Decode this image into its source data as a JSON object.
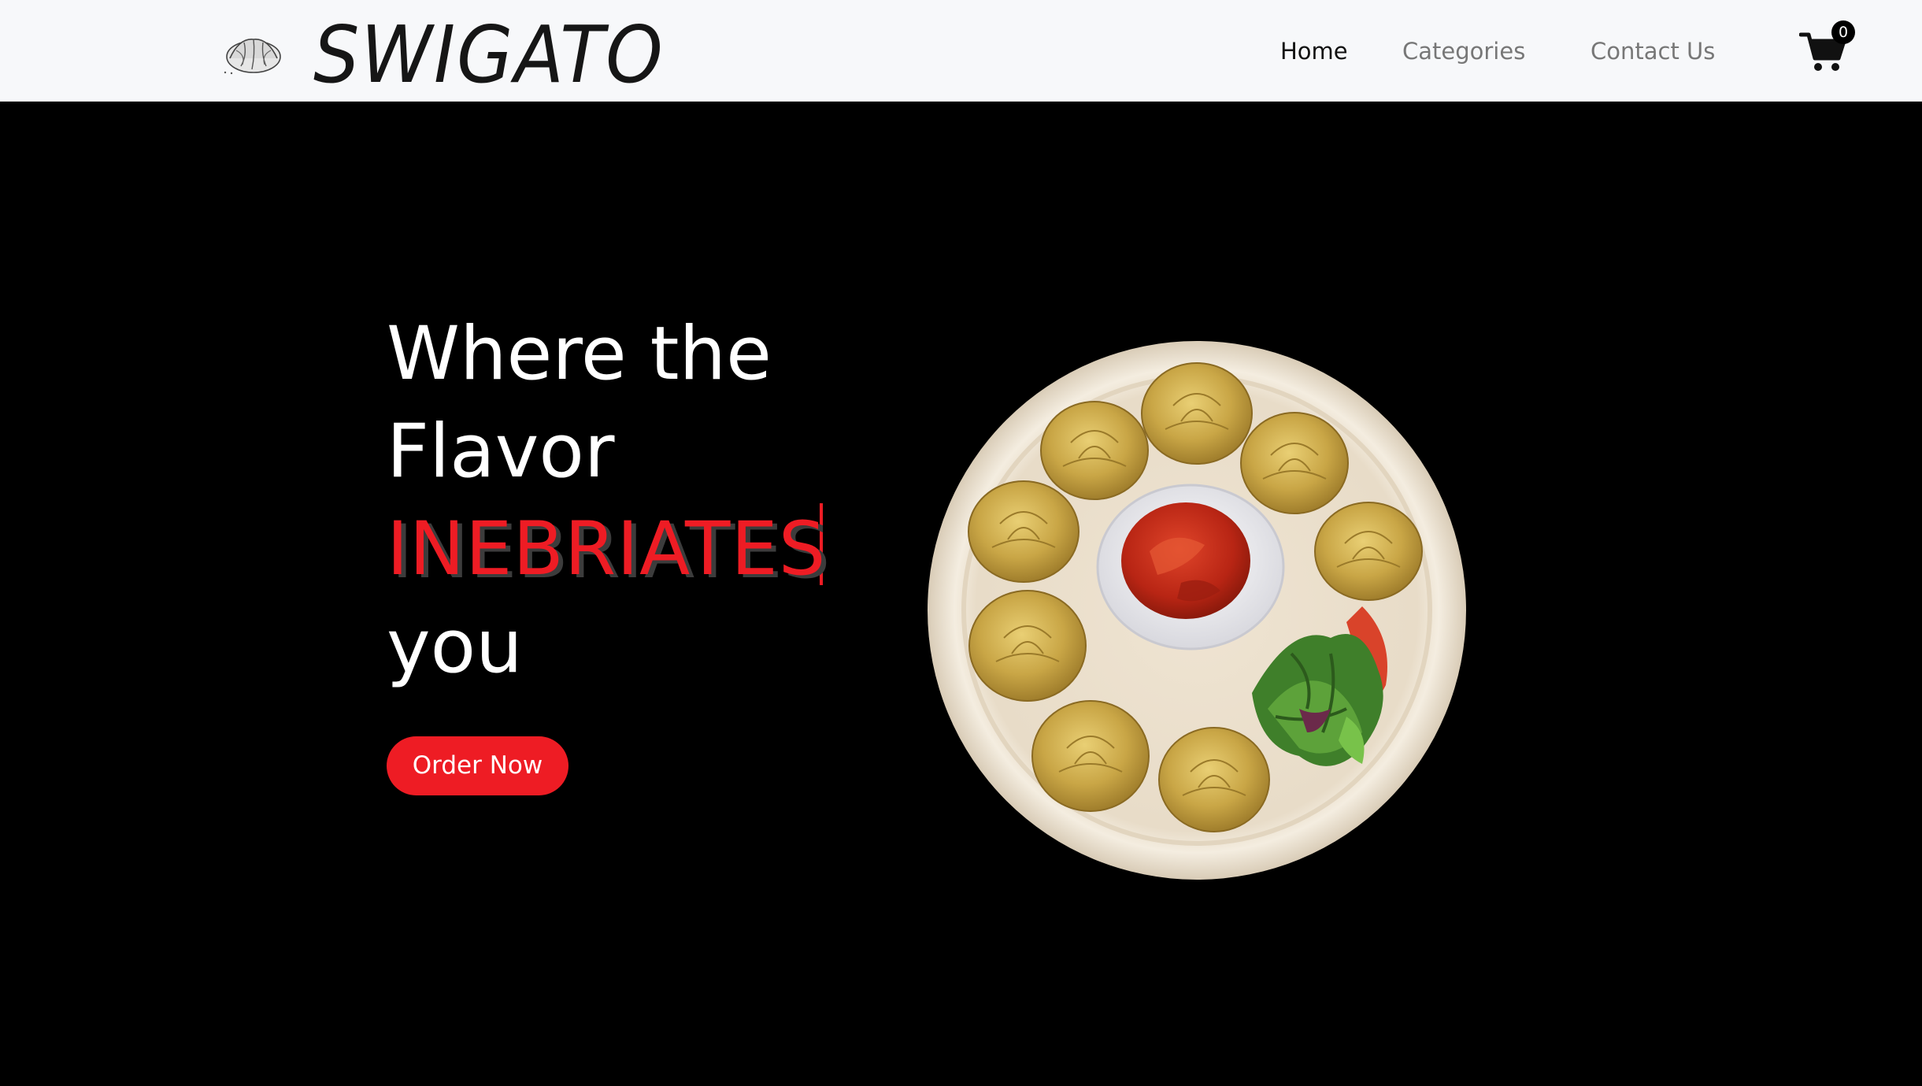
{
  "brand": {
    "name": "SWIGATO",
    "logo_icon": "dumpling-icon"
  },
  "nav": {
    "items": [
      {
        "label": "Home",
        "active": true
      },
      {
        "label": "Categories",
        "active": false
      },
      {
        "label": "Contact Us",
        "active": false
      }
    ],
    "cart": {
      "icon": "cart-icon",
      "count": "0"
    }
  },
  "hero": {
    "line1": "Where the",
    "line2": "Flavor",
    "highlight": "INEBRIATES",
    "line4": "you",
    "cta_label": "Order Now",
    "image": "momos-plate-with-sauce-and-salad"
  },
  "colors": {
    "accent": "#ee1c24",
    "navbar_bg": "#f7f8fa",
    "hero_bg": "#000000",
    "nav_active": "#111111",
    "nav_inactive": "#777777"
  }
}
